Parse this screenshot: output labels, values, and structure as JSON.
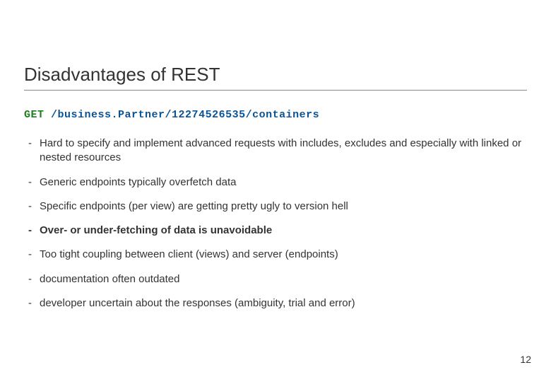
{
  "title": "Disadvantages of REST",
  "request": {
    "method": "GET",
    "path": "/business.Partner/12274526535/containers"
  },
  "bullets": [
    {
      "text": "Hard to specify and implement advanced requests with includes, excludes and especially with linked or nested resources",
      "bold": false
    },
    {
      "text": "Generic endpoints typically overfetch data",
      "bold": false
    },
    {
      "text": "Specific endpoints (per view) are getting pretty ugly to version hell",
      "bold": false
    },
    {
      "text": "Over- or under-fetching of data is unavoidable",
      "bold": true
    },
    {
      "text": "Too tight coupling between client (views) and server (endpoints)",
      "bold": false
    },
    {
      "text": "documentation often outdated",
      "bold": false
    },
    {
      "text": "developer uncertain about the responses (ambiguity, trial and error)",
      "bold": false
    }
  ],
  "page_number": "12"
}
